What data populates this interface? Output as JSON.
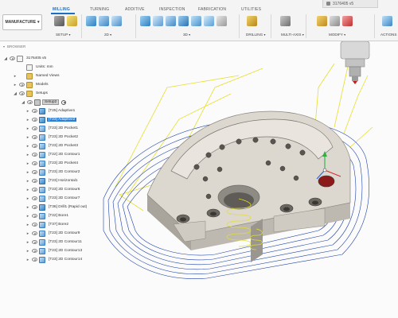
{
  "workspace": {
    "label": "MANUFACTURE"
  },
  "tabs": [
    {
      "label": "MILLING",
      "active": true
    },
    {
      "label": "TURNING",
      "active": false
    },
    {
      "label": "ADDITIVE",
      "active": false
    },
    {
      "label": "INSPECTION",
      "active": false
    },
    {
      "label": "FABRICATION",
      "active": false
    },
    {
      "label": "UTILITIES",
      "active": false
    }
  ],
  "groups": [
    {
      "label": "SETUP"
    },
    {
      "label": "2D"
    },
    {
      "label": "3D"
    },
    {
      "label": "DRILLING"
    },
    {
      "label": "MULTI-AXIS"
    },
    {
      "label": "MODIFY"
    },
    {
      "label": "ACTIONS"
    }
  ],
  "document": {
    "title": "3176405 v5"
  },
  "browser": {
    "title": "BROWSER",
    "root": "3176405 v5",
    "units": "Units: mm",
    "named_views": "Named Views",
    "models": "Models",
    "setups": "Setups",
    "setup": "Setup2",
    "operations": [
      "[T25] Adaptive1",
      "[T23] Adaptive2",
      "[T23] 2D Pocket1",
      "[T23] 2D Pocket2",
      "[T23] 2D Pocket3",
      "[T22] 2D Contour1",
      "[T23] 2D Pocket4",
      "[T23] 2D Contour2",
      "[T23] Horizontal1",
      "[T23] 2D Contour6",
      "[T23] 2D Contour7",
      "[T36] Drill1 (Rapid out)",
      "[T22] Bore1",
      "[T37] Bore2",
      "[T23] 2D Contour9",
      "[T23] 2D Contour11",
      "[T23] 2D Contour13",
      "[T23] 2D Contour14"
    ],
    "selected_operation": "[T23] Adaptive2"
  },
  "colors": {
    "accent": "#1a6fc4",
    "toolpath_yellow": "#e6df2a",
    "toolpath_blue": "#1c3fa8",
    "part": "#d9d4cc",
    "x_axis": "#d83030",
    "y_axis": "#30b040",
    "z_axis": "#3060d8"
  },
  "icons": {
    "workspace_caret": "chevron-down-icon",
    "tool_holder": "milling-tool-icon"
  }
}
